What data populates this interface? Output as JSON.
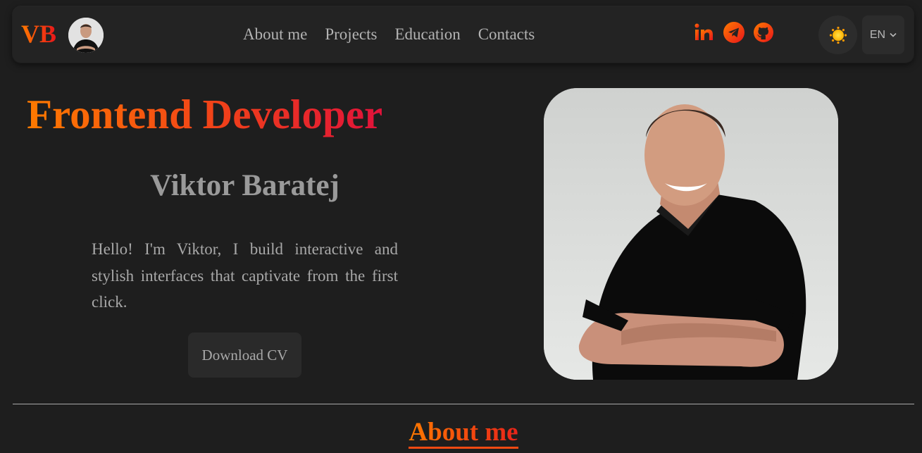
{
  "header": {
    "logo_text": "VB",
    "nav": [
      {
        "label": "About me"
      },
      {
        "label": "Projects"
      },
      {
        "label": "Education"
      },
      {
        "label": "Contacts"
      }
    ],
    "socials": [
      "linkedin-icon",
      "telegram-icon",
      "github-icon"
    ],
    "theme_icon": "sun-icon",
    "language": "EN"
  },
  "hero": {
    "title": "Frontend Developer",
    "name": "Viktor Baratej",
    "intro": "Hello! I'm Viktor, I build interactive and stylish interfaces that captivate from the first click.",
    "cv_button": "Download CV"
  },
  "about": {
    "title": "About me"
  },
  "colors": {
    "background": "#1e1e1e",
    "header_bg": "#232323",
    "accent_orange": "#ff7a00",
    "accent_red": "#e8151b",
    "text_muted": "#a8a8a8"
  }
}
